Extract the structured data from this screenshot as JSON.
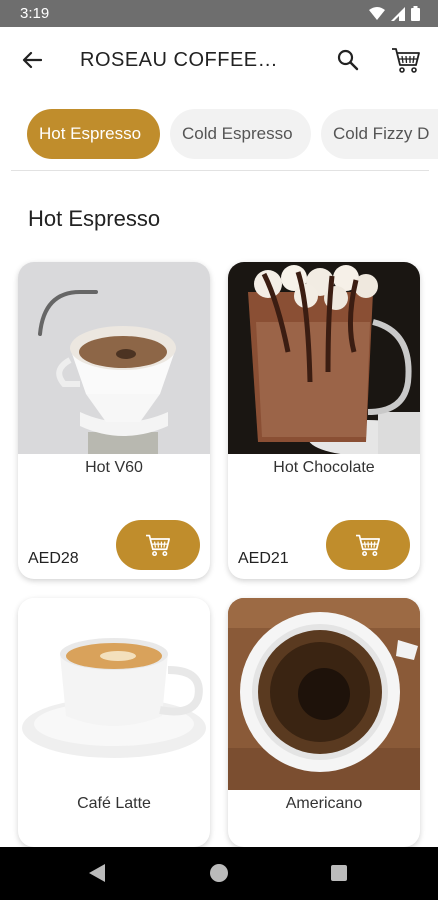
{
  "status_bar": {
    "time": "3:19",
    "icons": [
      "wifi-icon",
      "signal-icon",
      "battery-icon"
    ]
  },
  "app_bar": {
    "title": "ROSEAU COFFEE…",
    "icons": [
      "back-arrow-icon",
      "search-icon",
      "cart-icon"
    ]
  },
  "tabs": [
    {
      "label": "Hot Espresso",
      "active": true
    },
    {
      "label": "Cold Espresso",
      "active": false
    },
    {
      "label": "Cold Fizzy D",
      "active": false
    }
  ],
  "section": {
    "title": "Hot Espresso"
  },
  "products": [
    {
      "name": "Hot V60",
      "price": "AED28"
    },
    {
      "name": "Hot Chocolate",
      "price": "AED21"
    },
    {
      "name": "Café Latte"
    },
    {
      "name": "Americano"
    }
  ],
  "colors": {
    "accent": "#c08d2c",
    "status_bar": "#6e6e6e",
    "nav_bar": "#000000",
    "tab_inactive": "#f2f2f2"
  }
}
